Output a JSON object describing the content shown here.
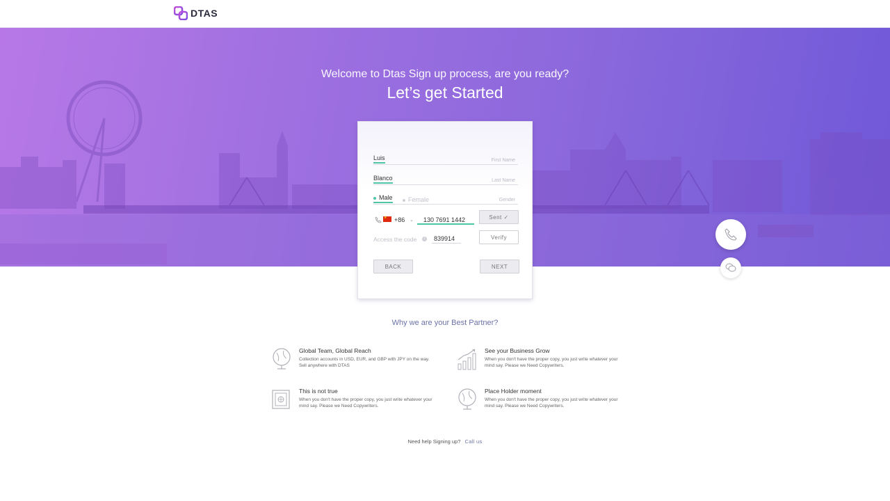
{
  "brand": {
    "name": "DTAS"
  },
  "hero": {
    "subtitle": "Welcome to Dtas Sign up process, are you ready?",
    "title": "Let’s get Started"
  },
  "form": {
    "first_name": {
      "value": "Luis",
      "label": "First Name"
    },
    "last_name": {
      "value": "Blanco",
      "label": "Last Name"
    },
    "gender": {
      "options": [
        "Male",
        "Female"
      ],
      "selected": "Male",
      "label": "Gender"
    },
    "phone": {
      "country_code": "+86",
      "number": "130 7691 1442"
    },
    "sent_button": "Sent ✓",
    "access_code": {
      "label": "Access the code",
      "value": "839914"
    },
    "verify_button": "Verify",
    "back_button": "BACK",
    "next_button": "NEXT"
  },
  "partner": {
    "title": "Why we are your Best Partner?",
    "features": [
      {
        "icon": "globe-icon",
        "title": "Global Team, Global Reach",
        "desc": "Collection accounts in USD, EUR, and GBP with JPY on the way. Sell anywhere with DTAS"
      },
      {
        "icon": "growth-chart-icon",
        "title": "See your Business Grow",
        "desc": "When you don't have the proper copy, you just write whatever your mind say. Please we Need Copywriters."
      },
      {
        "icon": "safe-icon",
        "title": "This is not true",
        "desc": "When you don't have the proper copy, you just write whatever your mind say. Please we Need Copywriters."
      },
      {
        "icon": "globe-icon",
        "title": "Place Holder moment",
        "desc": "When you don't have the proper copy, you just write whatever your mind say. Please we Need Copywriters."
      }
    ]
  },
  "help": {
    "text": "Need help Signing up?",
    "link": "Call us"
  },
  "colors": {
    "accent": "#4fc5a8",
    "link": "#6a72a8",
    "hero_start": "#b778e6",
    "hero_end": "#6f58d8"
  }
}
